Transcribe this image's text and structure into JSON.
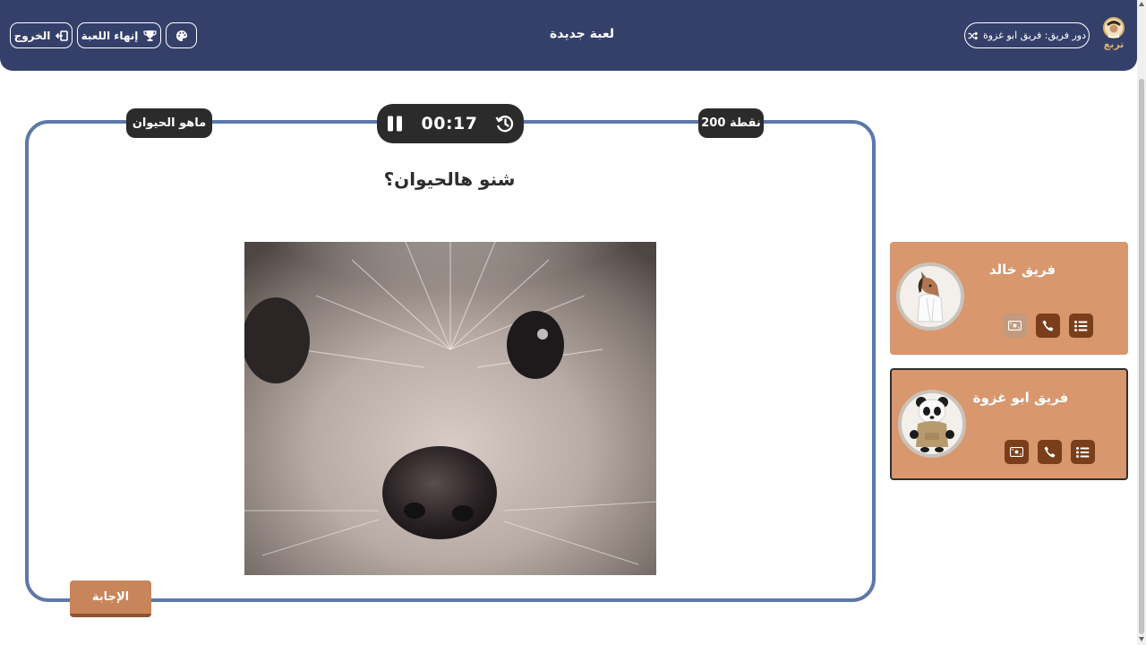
{
  "header": {
    "title": "لعبة جديدة",
    "exit_label": "الخروج",
    "end_game_label": "إنهاء اللعبة",
    "turn_label": "دور فريق: فريق ابو غزوة",
    "logo_text": "تربع",
    "palette_icon": "palette-icon",
    "exit_icon": "exit-icon",
    "trophy_icon": "trophy-icon",
    "shuffle_icon": "shuffle-icon"
  },
  "question": {
    "category": "ماهو الحيوان",
    "points": "200 نقطة",
    "timer": "00:17",
    "text": "شنو هالحيوان؟",
    "image_alt": "hedgehog close-up photo",
    "answer_label": "الإجابة"
  },
  "teams": [
    {
      "name": "فريق خالد",
      "avatar": "horse-avatar",
      "swap_disabled": true
    },
    {
      "name": "فريق ابو غزوة",
      "avatar": "panda-avatar",
      "swap_disabled": false,
      "active": true
    }
  ],
  "colors": {
    "header": "#34406a",
    "frame": "#5d78a8",
    "team_card": "#d8976d",
    "team_button": "#7a3e1a",
    "answer_button": "#c8855a",
    "logo_gold": "#d8b06a"
  }
}
